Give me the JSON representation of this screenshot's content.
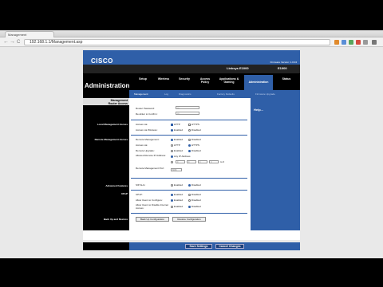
{
  "browser": {
    "tab_title": "Management",
    "back_glyph": "←",
    "forward_glyph": "→",
    "reload_glyph": "C",
    "url": "192.168.1.1/Management.asp"
  },
  "header": {
    "logo_text": "CISCO",
    "firmware": "Firmware Version: 1.0.04",
    "model_name": "Linksys E1000",
    "model_code": "E1000",
    "section_title": "Administration"
  },
  "nav": {
    "tabs": [
      {
        "label": "Setup"
      },
      {
        "label": "Wireless"
      },
      {
        "label": "Security"
      },
      {
        "label": "Access Policy"
      },
      {
        "label": "Applications & Gaming"
      },
      {
        "label": "Administration"
      },
      {
        "label": "Status"
      }
    ],
    "subtabs": [
      {
        "label": "Management"
      },
      {
        "label": "Log"
      },
      {
        "label": "Diagnostics"
      },
      {
        "label": "Factory Defaults"
      },
      {
        "label": "Firmware Upgrade"
      }
    ]
  },
  "left": {
    "head_a": "Management",
    "head_b": "Router Access",
    "local_mgmt": "Local Management Access",
    "remote_mgmt": "Remote Management Access",
    "advanced": "Advanced Features",
    "upnp": "UPnP",
    "backup": "Back Up and Restore"
  },
  "form": {
    "router_password_label": "Router Password:",
    "router_password_value": "•••",
    "reenter_label": "Re-Enter to Confirm:",
    "reenter_value": "•••",
    "access_via_label": "Access via:",
    "http": "HTTP",
    "https": "HTTPS",
    "access_wireless_label": "Access via Wireless:",
    "enabled": "Enabled",
    "disabled": "Disabled",
    "remote_mgmt_label": "Remote Management:",
    "remote_access_label": "Access via:",
    "remote_upgrade_label": "Remote Upgrade:",
    "allowed_ip_label": "Allowed Remote IP Address:",
    "any_ip": "Any IP Address",
    "ip_octets": [
      "0",
      "0",
      "0",
      "0"
    ],
    "ip_to": "to  0",
    "remote_port_label": "Remote Management Port:",
    "remote_port_value": "8080",
    "sip_alg_label": "SIP ALG:",
    "upnp_label": "UPnP:",
    "allow_users_config_label": "Allow Users to Configure:",
    "allow_users_disable_label": "Allow Users to Disable Internet Access:",
    "backup_btn": "Back Up Configuration",
    "restore_btn": "Restore Configuration"
  },
  "help": {
    "label": "Help..."
  },
  "footer": {
    "save": "Save Settings",
    "cancel": "Cancel Changes"
  },
  "colors": {
    "accent": "#2f5fa8",
    "header_dark": "#000000"
  }
}
